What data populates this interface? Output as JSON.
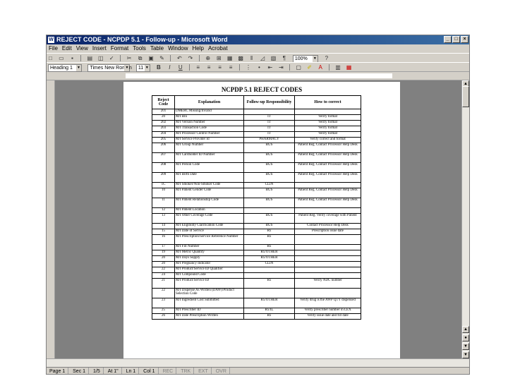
{
  "window": {
    "title": "REJECT CODE - NCPDP 5.1 - Follow-up - Microsoft Word",
    "app_icon": "W"
  },
  "menubar": {
    "items": [
      "File",
      "Edit",
      "View",
      "Insert",
      "Format",
      "Tools",
      "Table",
      "Window",
      "Help",
      "Acrobat"
    ]
  },
  "toolbar": {
    "zoom": "100%",
    "style": "Heading 1",
    "font": "Times New Roman",
    "size": "11"
  },
  "document": {
    "title": "NCPDP 5.1 REJECT CODES",
    "headers": [
      "Reject Code",
      "Explanation",
      "Follow-up Responsibility",
      "How to correct"
    ],
    "rows": [
      {
        "code": "201",
        "explanation": "DMERC Missing/Invalid",
        "responsibility": "",
        "correct": "",
        "tall": false
      },
      {
        "code": "20",
        "explanation": "M/I Bin",
        "responsibility": "IT",
        "correct": "Verify format",
        "tall": false
      },
      {
        "code": "202",
        "explanation": "M/I Version Number",
        "responsibility": "IT",
        "correct": "Verify format",
        "tall": false
      },
      {
        "code": "203",
        "explanation": "M/I Transaction Code",
        "responsibility": "IT",
        "correct": "Verify format",
        "tall": false
      },
      {
        "code": "204",
        "explanation": "M/I Processor Control Number",
        "responsibility": "IT",
        "correct": "Verify format",
        "tall": false
      },
      {
        "code": "205",
        "explanation": "M/I Service Provider Id",
        "responsibility": "PHARMACY",
        "correct": "Verify correct and format",
        "tall": false
      },
      {
        "code": "206",
        "explanation": "M/I Group Number",
        "responsibility": "BUS",
        "correct": "Patient Reg. Contact Processor Help Desk",
        "tall": true
      },
      {
        "code": "207",
        "explanation": "M/I Cardholder ID Number",
        "responsibility": "BUS",
        "correct": "Patient Reg. Contact Processor Help Desk",
        "tall": true
      },
      {
        "code": "208",
        "explanation": "M/I Person Code",
        "responsibility": "BUS",
        "correct": "Patient Reg. Contact Processor Help Desk",
        "tall": true
      },
      {
        "code": "209",
        "explanation": "M/I Birth Date",
        "responsibility": "BUS",
        "correct": "Patient Reg. Contact Processor Help Desk",
        "tall": true
      },
      {
        "code": "1C",
        "explanation": "M/I Smoker/Non-Smoker Code",
        "responsibility": "CLIN",
        "correct": "",
        "tall": false
      },
      {
        "code": "10",
        "explanation": "M/I Patient Gender Code",
        "responsibility": "BUS",
        "correct": "Patient Reg. Contact Processor Help Desk",
        "tall": true
      },
      {
        "code": "11",
        "explanation": "M/I Patient Relationship Code",
        "responsibility": "BUS",
        "correct": "Patient Reg. Contact Processor Help Desk",
        "tall": true
      },
      {
        "code": "12",
        "explanation": "M/I Patient Location",
        "responsibility": "",
        "correct": "",
        "tall": false
      },
      {
        "code": "13",
        "explanation": "M/I Other Coverage Code",
        "responsibility": "BUS",
        "correct": "Patient Reg. Verify coverage with Patient",
        "tall": true
      },
      {
        "code": "14",
        "explanation": "M/I Eligibility Clarification Code",
        "responsibility": "BUS",
        "correct": "Contact Processor Help Desk",
        "tall": false
      },
      {
        "code": "15",
        "explanation": "M/I Date of Service",
        "responsibility": "Rx",
        "correct": "Prescription issue date",
        "tall": false
      },
      {
        "code": "16",
        "explanation": "M/I Prescription/Service Reference Number",
        "responsibility": "Rx",
        "correct": "",
        "tall": true
      },
      {
        "code": "17",
        "explanation": "M/I Fill Number",
        "responsibility": "Rx",
        "correct": "",
        "tall": false
      },
      {
        "code": "19",
        "explanation": "M/I Metric Quantity",
        "responsibility": "Rx/OTHER",
        "correct": "",
        "tall": false
      },
      {
        "code": "20",
        "explanation": "M/I Days Supply",
        "responsibility": "Rx/OTHER",
        "correct": "",
        "tall": false
      },
      {
        "code": "20",
        "explanation": "M/I Pregnancy Indicator",
        "responsibility": "CLIN",
        "correct": "",
        "tall": false
      },
      {
        "code": "22",
        "explanation": "M/I Product/Service ID Qualifier",
        "responsibility": "",
        "correct": "",
        "tall": false
      },
      {
        "code": "24",
        "explanation": "M/I Compound Code",
        "responsibility": "",
        "correct": "",
        "tall": false
      },
      {
        "code": "21",
        "explanation": "M/I Product/Service ID",
        "responsibility": "Rx",
        "correct": "Verify NDC number",
        "tall": true
      },
      {
        "code": "22",
        "explanation": "M/I Dispense As Written (DAW)/Product Selection Code",
        "responsibility": "",
        "correct": "",
        "tall": true
      },
      {
        "code": "23",
        "explanation": "M/I Ingredient Cost Submitted",
        "responsibility": "Rx/OTHER",
        "correct": "Verify drug is the AWP QTY dispensed",
        "tall": true
      },
      {
        "code": "25",
        "explanation": "M/I Prescriber ID",
        "responsibility": "Rx/IL",
        "correct": "Verify prescriber number in LEX",
        "tall": false
      },
      {
        "code": "26",
        "explanation": "M/I Date Prescription Written",
        "responsibility": "Rx",
        "correct": "Verify issue date and fill date",
        "tall": false
      }
    ]
  },
  "statusbar": {
    "page": "Page 1",
    "section": "Sec 1",
    "pages": "1/5",
    "at": "At 1\"",
    "ln": "Ln 1",
    "col": "Col 1",
    "flags": [
      "REC",
      "TRK",
      "EXT",
      "OVR"
    ]
  }
}
